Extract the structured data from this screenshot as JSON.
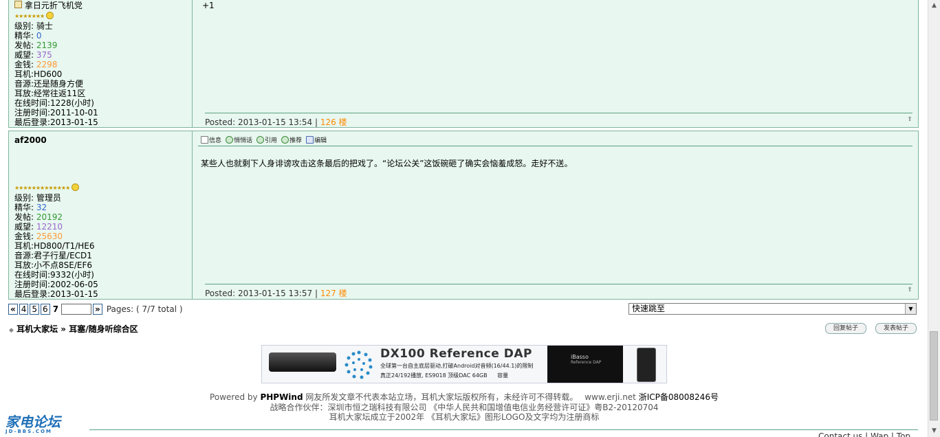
{
  "post1": {
    "title_line": "拿日元折飞机党",
    "level_label": "级别:",
    "level": "骑士",
    "jinghua_label": "精华:",
    "jinghua": "0",
    "posts_label": "发帖:",
    "posts": "2139",
    "weiwang_label": "威望:",
    "weiwang": "375",
    "money_label": "金钱:",
    "money": "2298",
    "earphone": "耳机:HD600",
    "source": "音源:还是随身方便",
    "amp": "耳放:经常往返11区",
    "online": "在线时间:1228(小时)",
    "register": "注册时间:2011-10-01",
    "lastlogin": "最后登录:2013-01-15",
    "content": "+1",
    "posted": "Posted: 2013-01-15 13:54",
    "sep": "|",
    "floor": "126 楼"
  },
  "post2": {
    "username": "af2000",
    "level_label": "级别:",
    "level": "管理员",
    "jinghua_label": "精华:",
    "jinghua": "32",
    "posts_label": "发帖:",
    "posts": "20192",
    "weiwang_label": "威望:",
    "weiwang": "12210",
    "money_label": "金钱:",
    "money": "25630",
    "earphone": "耳机:HD800/T1/HE6",
    "source": "音源:君子行星/ECD1",
    "amp": "耳放:小不点8SE/EF6",
    "online": "在线时间:9332(小时)",
    "register": "注册时间:2002-06-05",
    "lastlogin": "最后登录:2013-01-15",
    "toolbar": [
      "信息",
      "悄悄话",
      "引用",
      "推荐",
      "编辑"
    ],
    "content": "某些人也就剩下人身诽谤攻击这条最后的把戏了。“论坛公关”这饭碗砸了确实会恼羞成怒。走好不送。",
    "posted": "Posted: 2013-01-15 13:57",
    "sep": "|",
    "floor": "127 楼"
  },
  "pagination": {
    "prev": "«",
    "pages": [
      "4",
      "5",
      "6"
    ],
    "current": "7",
    "next": "»",
    "info": "Pages: ( 7/7 total )"
  },
  "jump": {
    "label": "快速跳至"
  },
  "breadcrumb": "耳机大家坛 » 耳塞/随身听综合区",
  "buttons": {
    "reply": "回复帖子",
    "newpost": "发表帖子"
  },
  "banner": {
    "title": "DX100 Reference DAP",
    "line1": "全球第一台自主底层驱动,打破Android对音频(16/44.1)的限制",
    "line2": "真正24/192播放, ES9018 顶级DAC 64GB",
    "line2b": "容量",
    "brand": "iBasso",
    "brand_sub": "Reference DAP"
  },
  "footer": {
    "powered_prefix": "Powered by",
    "powered_brand": "PHPWind",
    "line1_rest": "网友所发文章不代表本站立场，耳机大家坛版权所有，未经许可不得转载。",
    "site": "www.erji.net",
    "icp": "浙ICP备08008246号",
    "line2": "战略合作伙伴：深圳市恒之瑞科技有限公司 《中华人民共和国增值电信业务经营许可证》粤B2-20120704",
    "line3": "耳机大家坛成立于2002年  《耳机大家坛》图形LOGO及文字均为注册商标"
  },
  "logo": {
    "text": "家电论坛",
    "sub": "JD-BBS.COM"
  },
  "bottom_links": "Contact us | Wap | Top"
}
